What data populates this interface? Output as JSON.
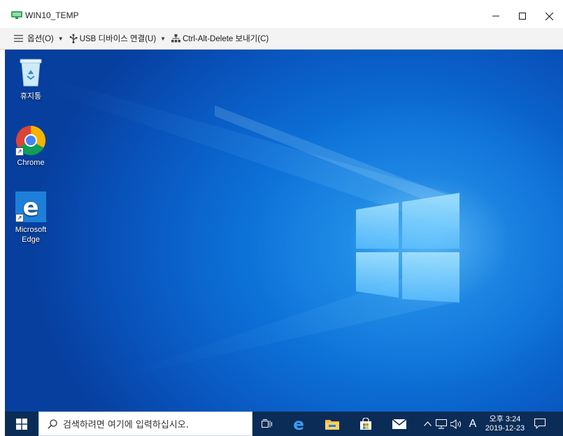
{
  "window": {
    "title": "WIN10_TEMP",
    "minimize_label": "—",
    "maximize_label": "☐",
    "close_label": "✕"
  },
  "toolbar": {
    "options_label": "옵션(O)",
    "usb_label": "USB 디바이스 연결(U)",
    "cad_label": "Ctrl-Alt-Delete 보내기(C)"
  },
  "desktop": {
    "icons": [
      {
        "label": "휴지통"
      },
      {
        "label": "Chrome"
      },
      {
        "label": "Microsoft Edge"
      }
    ]
  },
  "taskbar": {
    "search_placeholder": "검색하려면 여기에 입력하십시오.",
    "input_indicator": "A",
    "time": "오후 3:24",
    "date": "2019-12-23"
  },
  "colors": {
    "taskbar": "#0a2c56",
    "desktop_deep": "#073f9e",
    "desktop_light": "#1a8ee8",
    "toolbar_bg": "#f3f3f3"
  }
}
